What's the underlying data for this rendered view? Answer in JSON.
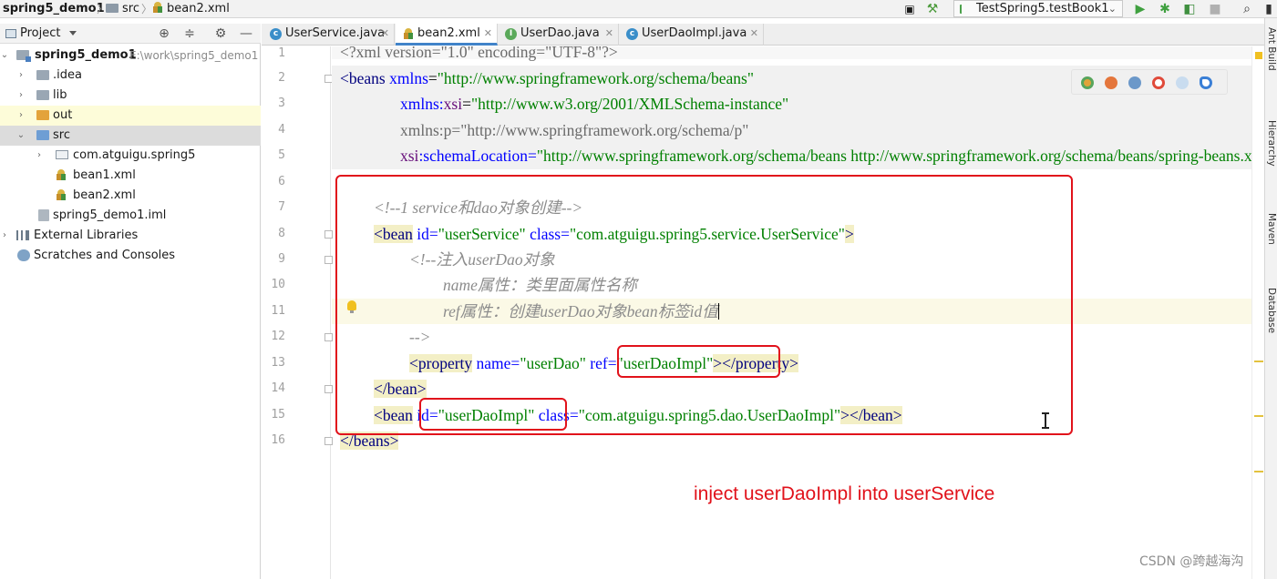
{
  "breadcrumb": {
    "project": "spring5_demo1",
    "folder": "src",
    "file": "bean2.xml"
  },
  "run_config": {
    "selected": "TestSpring5.testBook1"
  },
  "project_panel": {
    "title": "Project",
    "tree": [
      {
        "label": "spring5_demo1",
        "path": "E:\\work\\spring5_demo1"
      },
      {
        "label": ".idea"
      },
      {
        "label": "lib"
      },
      {
        "label": "out"
      },
      {
        "label": "src"
      },
      {
        "label": "com.atguigu.spring5"
      },
      {
        "label": "bean1.xml"
      },
      {
        "label": "bean2.xml"
      },
      {
        "label": "spring5_demo1.iml"
      },
      {
        "label": "External Libraries"
      },
      {
        "label": "Scratches and Consoles"
      }
    ]
  },
  "tabs": [
    {
      "label": "UserService.java",
      "icon": "class-icon"
    },
    {
      "label": "bean2.xml",
      "icon": "xml-icon",
      "active": true
    },
    {
      "label": "UserDao.java",
      "icon": "interface-icon"
    },
    {
      "label": "UserDaoImpl.java",
      "icon": "class-icon"
    }
  ],
  "editor": {
    "line_numbers": [
      "1",
      "2",
      "3",
      "4",
      "5",
      "6",
      "7",
      "8",
      "9",
      "10",
      "11",
      "12",
      "13",
      "14",
      "15",
      "16"
    ],
    "code": {
      "l1": "<?xml version=\"1.0\" encoding=\"UTF-8\"?>",
      "l2_tag": "<beans",
      "l2_attr": "xmlns",
      "l2_val": "\"http://www.springframework.org/schema/beans\"",
      "l3_ns": "xmlns:",
      "l3_attr": "xsi",
      "l3_val": "\"http://www.w3.org/2001/XMLSchema-instance\"",
      "l4_attr": "xmlns:p=",
      "l4_val": "\"http://www.springframework.org/schema/p\"",
      "l5_ns": "xsi",
      "l5_attr": ":schemaLocation=",
      "l5_val": "\"http://www.springframework.org/schema/beans http://www.springframework.org/schema/beans/spring-beans.xsd\">",
      "l7": "<!--1 service和dao对象创建-->",
      "l8_tag": "<bean",
      "l8_attr1": "id=",
      "l8_val1": "\"userService\"",
      "l8_attr2": "class=",
      "l8_val2": "\"com.atguigu.spring5.service.UserService\"",
      "l8_end": ">",
      "l9": "<!--注入userDao对象",
      "l10": "name属性：类里面属性名称",
      "l11": "ref属性：创建userDao对象bean标签id值",
      "l12": "-->",
      "l13_tag": "<property",
      "l13_attr1": "name=",
      "l13_val1": "\"userDao\"",
      "l13_attr2": "ref=",
      "l13_val2": "\"userDaoImpl\"",
      "l13_end": "></property>",
      "l14": "</bean>",
      "l15_tag": "<bean",
      "l15_attr1": "id=",
      "l15_val1": "\"userDaoImpl\"",
      "l15_attr2": "class=",
      "l15_val2": "\"com.atguigu.spring5.dao.UserDaoImpl\"",
      "l15_end": "></bean>",
      "l16": "</beans>"
    }
  },
  "annotation": {
    "note": "inject userDaoImpl into userService",
    "color": "#e1121b"
  },
  "right_tool_windows": [
    "Ant Build",
    "Hierarchy",
    "Maven",
    "Database"
  ],
  "watermark": "CSDN @跨越海沟"
}
